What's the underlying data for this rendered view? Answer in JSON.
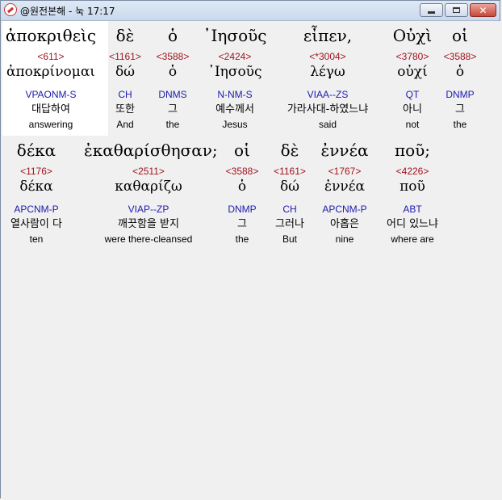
{
  "window": {
    "title": "@원전본해 - 눅 17:17",
    "buttons": {
      "minimize": "minimize",
      "maximize": "maximize",
      "close": "✕"
    }
  },
  "rows": [
    {
      "words": [
        {
          "greek": "ἀποκριθεὶς",
          "strong": "<611>",
          "lemma": "ἀποκρίνομαι",
          "parse": "VPAONM-S",
          "korean": "대답하여",
          "english": "answering"
        },
        {
          "greek": "δὲ",
          "strong": "<1161>",
          "lemma": "δώ",
          "parse": "CH",
          "korean": "또한",
          "english": "And"
        },
        {
          "greek": "ὁ",
          "strong": "<3588>",
          "lemma": "ὁ",
          "parse": "DNMS",
          "korean": "그",
          "english": "the"
        },
        {
          "greek": "᾽Ιησοῦς",
          "strong": "<2424>",
          "lemma": "᾽Ιησοῦς",
          "parse": "N-NM-S",
          "korean": "예수께서",
          "english": "Jesus"
        },
        {
          "greek": "εἶπεν,",
          "strong": "<*3004>",
          "lemma": "λέγω",
          "parse": "VIAA--ZS",
          "korean": "가라사대-하였느냐",
          "english": "said"
        },
        {
          "greek": "Οὐχὶ",
          "strong": "<3780>",
          "lemma": "οὐχί",
          "parse": "QT",
          "korean": "아니",
          "english": "not"
        },
        {
          "greek": "οἱ",
          "strong": "<3588>",
          "lemma": "ὁ",
          "parse": "DNMP",
          "korean": "그",
          "english": "the"
        }
      ]
    },
    {
      "words": [
        {
          "greek": "δέκα",
          "strong": "<1176>",
          "lemma": "δέκα",
          "parse": "APCNM-P",
          "korean": "열사람이 다",
          "english": "ten"
        },
        {
          "greek": "ἐκαθαρίσθησαν;",
          "strong": "<2511>",
          "lemma": "καθαρίζω",
          "parse": "VIAP--ZP",
          "korean": "깨끗함을 받지",
          "english": "were there-cleansed"
        },
        {
          "greek": "οἱ",
          "strong": "<3588>",
          "lemma": "ὁ",
          "parse": "DNMP",
          "korean": "그",
          "english": "the"
        },
        {
          "greek": "δὲ",
          "strong": "<1161>",
          "lemma": "δώ",
          "parse": "CH",
          "korean": "그러나",
          "english": "But"
        },
        {
          "greek": "ἐννέα",
          "strong": "<1767>",
          "lemma": "ἐννέα",
          "parse": "APCNM-P",
          "korean": "아홉은",
          "english": "nine"
        },
        {
          "greek": "ποῦ;",
          "strong": "<4226>",
          "lemma": "ποῦ",
          "parse": "ABT",
          "korean": "어디 있느냐",
          "english": "where are"
        }
      ]
    }
  ]
}
